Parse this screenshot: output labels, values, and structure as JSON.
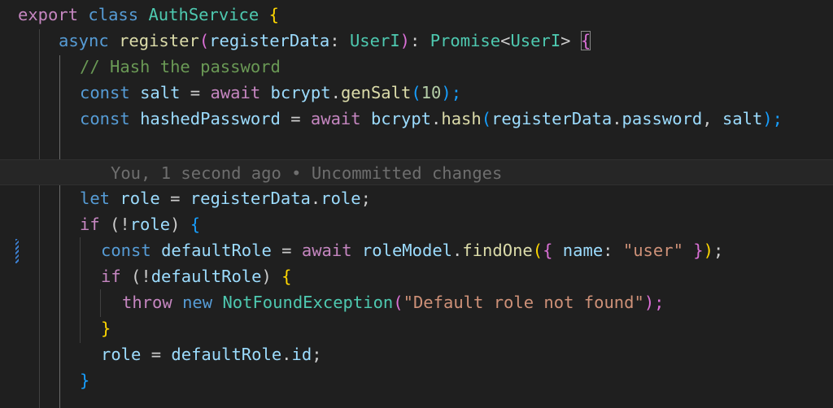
{
  "lines": [
    {
      "t": [
        "export",
        " ",
        "class",
        " ",
        "AuthService",
        " ",
        "{"
      ]
    },
    {
      "t": [
        "async",
        " ",
        "register",
        "(",
        "registerData",
        ": ",
        "UserI",
        ")",
        ": ",
        "Promise",
        "<",
        "UserI",
        "> ",
        "{"
      ]
    },
    {
      "t": [
        "// Hash the password"
      ]
    },
    {
      "t": [
        "const",
        " ",
        "salt",
        " = ",
        "await",
        " ",
        "bcrypt",
        ".",
        "genSalt",
        "(",
        "10",
        ");"
      ]
    },
    {
      "t": [
        "const",
        " ",
        "hashedPassword",
        " = ",
        "await",
        " ",
        "bcrypt",
        ".",
        "hash",
        "(",
        "registerData",
        ".",
        "password",
        ", ",
        "salt",
        ");"
      ]
    },
    {
      "t": []
    },
    {
      "t": [
        "You, 1 second ago • Uncommitted changes"
      ]
    },
    {
      "t": [
        "let",
        " ",
        "role",
        " = ",
        "registerData",
        ".",
        "role",
        ";"
      ]
    },
    {
      "t": [
        "if",
        " (!",
        "role",
        ") ",
        "{"
      ]
    },
    {
      "t": [
        "const",
        " ",
        "defaultRole",
        " = ",
        "await",
        " ",
        "roleModel",
        ".",
        "findOne",
        "(",
        "{",
        " ",
        "name",
        ": ",
        "\"user\"",
        " ",
        "}",
        ")",
        ";"
      ]
    },
    {
      "t": [
        "if",
        " (!",
        "defaultRole",
        ") ",
        "{"
      ]
    },
    {
      "t": [
        "throw",
        " ",
        "new",
        " ",
        "NotFoundException",
        "(",
        "\"Default role not found\"",
        ");"
      ]
    },
    {
      "t": [
        "}"
      ]
    },
    {
      "t": [
        "role",
        " = ",
        "defaultRole",
        ".",
        "id",
        ";"
      ]
    },
    {
      "t": [
        "}"
      ]
    }
  ],
  "blame": {
    "text": "You, 1 second ago • Uncommitted changes"
  }
}
